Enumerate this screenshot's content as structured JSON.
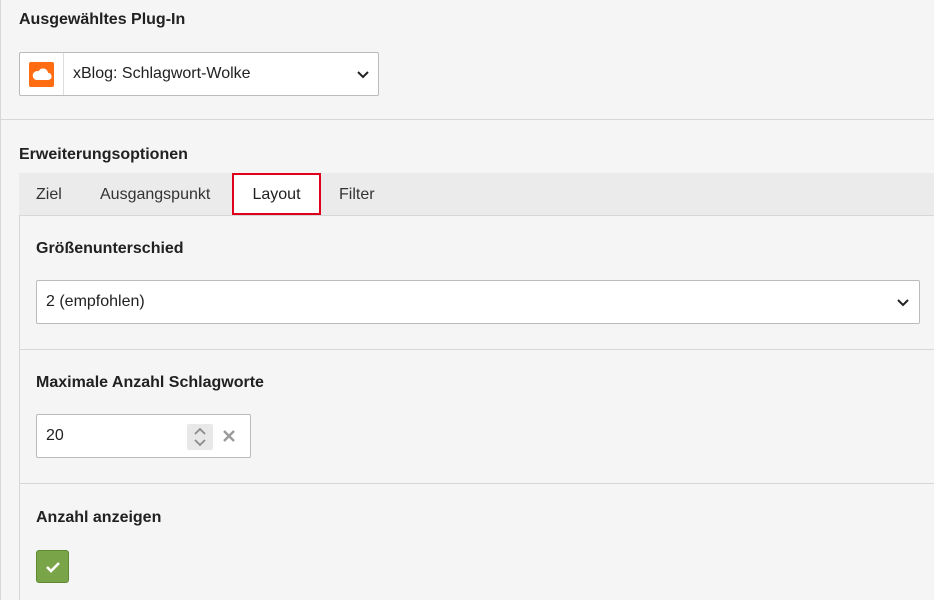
{
  "plugin_section": {
    "title": "Ausgewähltes Plug-In",
    "selected_plugin": "xBlog: Schlagwort-Wolke",
    "icon": "cloud-icon",
    "icon_color": "#ff6c11"
  },
  "extension_section": {
    "title": "Erweiterungsoptionen",
    "tabs": [
      {
        "label": "Ziel"
      },
      {
        "label": "Ausgangspunkt"
      },
      {
        "label": "Layout"
      },
      {
        "label": "Filter"
      }
    ],
    "active_tab": "Layout",
    "highlight_color": "#e0001b"
  },
  "layout_tab": {
    "size_difference": {
      "label": "Größenunterschied",
      "value": "2 (empfohlen)"
    },
    "max_tags": {
      "label": "Maximale Anzahl Schlagworte",
      "value": "20"
    },
    "show_count": {
      "label": "Anzahl anzeigen",
      "checked": true,
      "checkbox_color": "#79a548"
    }
  }
}
